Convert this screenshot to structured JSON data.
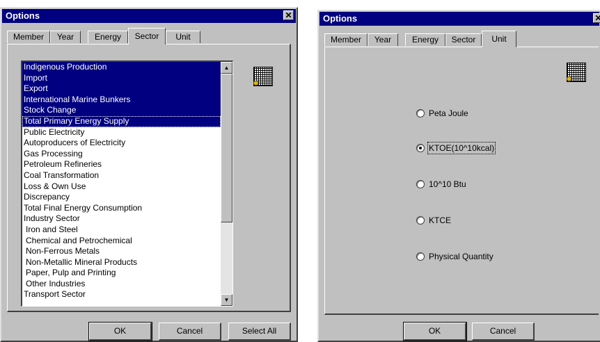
{
  "dialog1": {
    "title": "Options",
    "close": "✕",
    "tabs": [
      "Member",
      "Year",
      "Energy",
      "Sector",
      "Unit"
    ],
    "active_tab": "Sector",
    "sectors": [
      {
        "label": "Indigenous Production",
        "selected": true
      },
      {
        "label": "Import",
        "selected": true
      },
      {
        "label": "Export",
        "selected": true
      },
      {
        "label": "International Marine Bunkers",
        "selected": true
      },
      {
        "label": "Stock Change",
        "selected": true
      },
      {
        "label": "Total Primary Energy Supply",
        "selected": true
      },
      {
        "label": "Public Electricity",
        "selected": false
      },
      {
        "label": "Autoproducers of Electricity",
        "selected": false
      },
      {
        "label": "Gas Processing",
        "selected": false
      },
      {
        "label": "Petroleum Refineries",
        "selected": false
      },
      {
        "label": "Coal Transformation",
        "selected": false
      },
      {
        "label": "Loss & Own Use",
        "selected": false
      },
      {
        "label": "Discrepancy",
        "selected": false
      },
      {
        "label": "Total Final Energy Consumption",
        "selected": false
      },
      {
        "label": "Industry Sector",
        "selected": false
      },
      {
        "label": "Iron and Steel",
        "selected": false
      },
      {
        "label": "Chemical and Petrochemical",
        "selected": false
      },
      {
        "label": "Non-Ferrous Metals",
        "selected": false
      },
      {
        "label": "Non-Metallic Mineral Products",
        "selected": false
      },
      {
        "label": "Paper, Pulp and Printing",
        "selected": false
      },
      {
        "label": "Other Industries",
        "selected": false
      },
      {
        "label": "Transport Sector",
        "selected": false
      }
    ],
    "buttons": {
      "ok": "OK",
      "cancel": "Cancel",
      "select_all": "Select All"
    }
  },
  "dialog2": {
    "title": "Options",
    "close": "✕",
    "tabs": [
      "Member",
      "Year",
      "Energy",
      "Sector",
      "Unit"
    ],
    "active_tab": "Unit",
    "units": [
      {
        "label": "Peta Joule",
        "checked": false
      },
      {
        "label": "KTOE(10^10kcal)",
        "checked": true
      },
      {
        "label": "10^10 Btu",
        "checked": false
      },
      {
        "label": "KTCE",
        "checked": false
      },
      {
        "label": "Physical Quantity",
        "checked": false
      }
    ],
    "buttons": {
      "ok": "OK",
      "cancel": "Cancel"
    }
  },
  "colors": {
    "titlebar": "#000080",
    "face": "#c0c0c0",
    "selection": "#000080"
  },
  "icons": [
    "grid-icon",
    "close-icon",
    "scroll-up-icon",
    "scroll-down-icon"
  ]
}
